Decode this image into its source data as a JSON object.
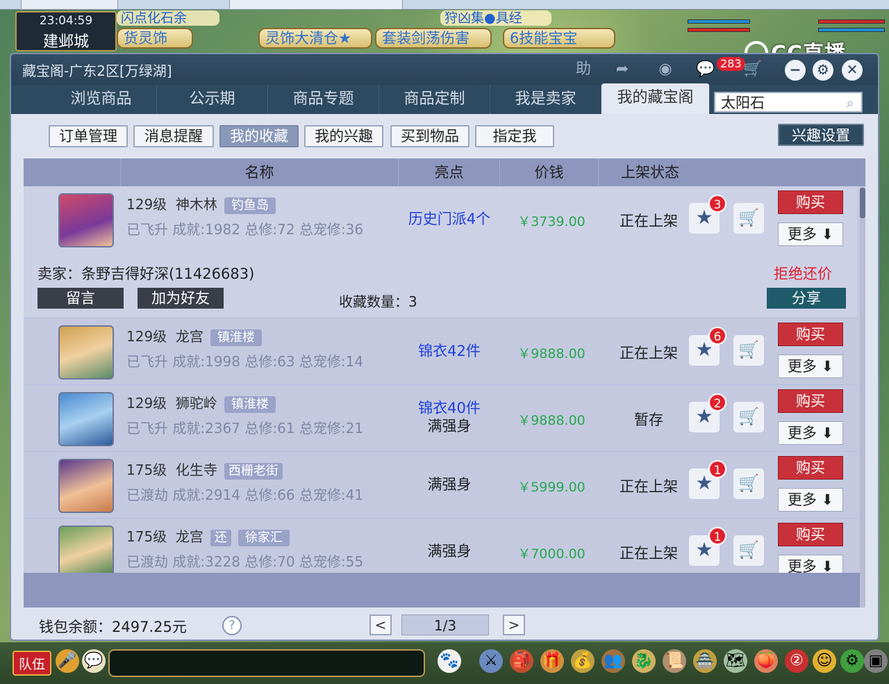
{
  "game": {
    "clock": "23:04:59",
    "city": "建邺城",
    "marquee": "闪点化石余",
    "marquee2": "狩凶集●具经",
    "quick_buttons": [
      "货灵饰",
      "灵饰大清仓★",
      "套装剑荡伤害",
      "6技能宝宝"
    ],
    "cc_logo": "CC直播",
    "team_label": "队伍"
  },
  "window": {
    "title": "藏宝阁-广东2区[万绿湖]",
    "help_label": "助",
    "chat_badge": "283"
  },
  "nav": {
    "tabs": [
      {
        "label": "浏览商品"
      },
      {
        "label": "公示期"
      },
      {
        "label": "商品专题"
      },
      {
        "label": "商品定制"
      },
      {
        "label": "我是卖家"
      },
      {
        "label": "我的藏宝阁"
      }
    ],
    "active_index": 5
  },
  "search": {
    "value": "太阳石"
  },
  "subtabs": {
    "items": [
      {
        "label": "订单管理"
      },
      {
        "label": "消息提醒"
      },
      {
        "label": "我的收藏"
      },
      {
        "label": "我的兴趣"
      },
      {
        "label": "买到物品"
      },
      {
        "label": "指定我"
      }
    ],
    "active_index": 2,
    "interest_settings": "兴趣设置"
  },
  "table": {
    "headers": {
      "name": "名称",
      "highlight": "亮点",
      "price": "价钱",
      "status": "上架状态"
    },
    "buy_label": "购买",
    "more_label": "更多 ⬇",
    "rows": [
      {
        "level": "129级",
        "school": "神木林",
        "server": "钓鱼岛",
        "stats": "已飞升  成就:1982  总修:72  总宠修:36",
        "highlight": [
          "历史门派4个"
        ],
        "price": "￥3739.00",
        "status": "正在上架",
        "fav_count": "3"
      },
      {
        "level": "129级",
        "school": "龙宫",
        "server": "镇淮楼",
        "stats": "已飞升  成就:1998  总修:63  总宠修:14",
        "highlight": [
          "锦衣42件"
        ],
        "price": "￥9888.00",
        "status": "正在上架",
        "fav_count": "6"
      },
      {
        "level": "129级",
        "school": "狮驼岭",
        "server": "镇淮楼",
        "stats": "已飞升  成就:2367  总修:61  总宠修:21",
        "highlight": [
          "锦衣40件",
          "满强身"
        ],
        "price": "￥9888.00",
        "status": "暂存",
        "fav_count": "2"
      },
      {
        "level": "175级",
        "school": "化生寺",
        "server": "西栅老街",
        "stats": "已渡劫  成就:2914  总修:66  总宠修:41",
        "highlight": [
          "满强身"
        ],
        "price": "￥5999.00",
        "status": "正在上架",
        "fav_count": "1"
      },
      {
        "level": "175级",
        "school": "龙宫",
        "badge": "还",
        "server": "徐家汇",
        "stats": "已渡劫  成就:3228  总修:70  总宠修:55",
        "highlight": [
          "满强身"
        ],
        "price": "￥7000.00",
        "status": "正在上架",
        "fav_count": "1"
      }
    ],
    "expanded": {
      "seller": "卖家：条野吉得好深(11426683)",
      "reject": "拒绝还价",
      "leave_msg": "留言",
      "add_friend": "加为好友",
      "fav_count_label": "收藏数量：3",
      "share": "分享"
    }
  },
  "footer": {
    "wallet": "钱包余额：2497.25元",
    "help": "?",
    "prev": "<",
    "next": ">",
    "page": "1/3"
  },
  "colors": {
    "nav_bg": "#2e4a60",
    "header_bg": "#8d96bd",
    "buy_red": "#c8303a",
    "price_green": "#28a850",
    "highlight_blue": "#2040d8"
  }
}
